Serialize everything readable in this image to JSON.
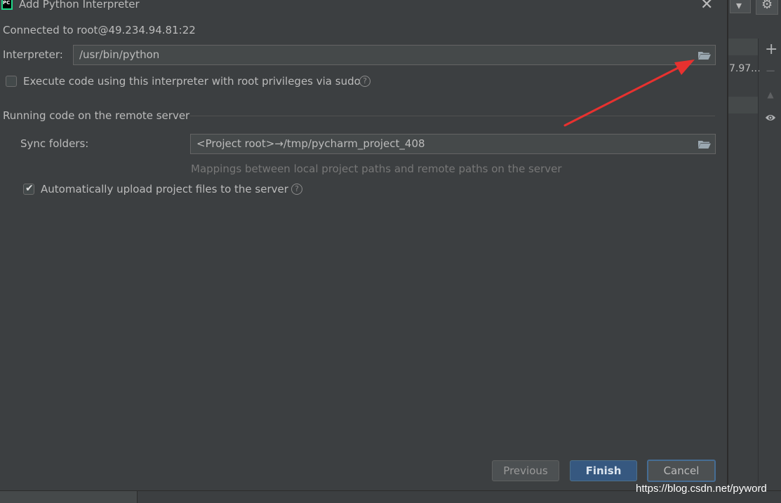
{
  "dialog": {
    "title": "Add Python Interpreter",
    "connected": "Connected to root@49.234.94.81:22",
    "interpreter_label": "Interpreter:",
    "interpreter_value": "/usr/bin/python",
    "sudo_label": "Execute code using this interpreter with root privileges via sudo",
    "sudo_checked": false,
    "section_title": "Running code on the remote server",
    "sync_label": "Sync folders:",
    "sync_value": "<Project root>→/tmp/pycharm_project_408",
    "sync_hint": "Mappings between local project paths and remote paths on the server",
    "auto_upload_label": "Automatically upload project files to the server",
    "auto_upload_checked": true,
    "help_glyph": "?",
    "check_glyph": "✔"
  },
  "buttons": {
    "previous": "Previous",
    "finish": "Finish",
    "cancel": "Cancel"
  },
  "background": {
    "truncated_text": "7.97...",
    "plus_glyph": "+",
    "minus_glyph": "−",
    "up_glyph": "▲",
    "dropdown_glyph": "▾",
    "gear_glyph": "⚙",
    "close_glyph": "✕",
    "app_icon_text": "PC"
  },
  "watermark": "https://blog.csdn.net/pyword",
  "colors": {
    "accent_blue": "#365880",
    "focus_border": "#466d94",
    "annotation_arrow": "#e8312f"
  }
}
